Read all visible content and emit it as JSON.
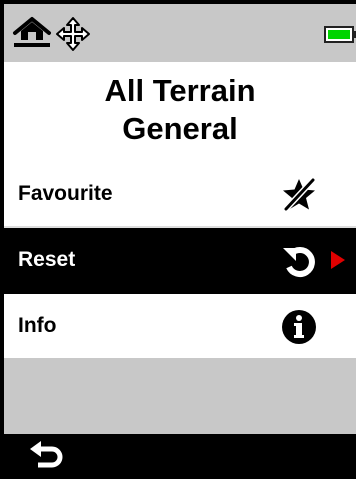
{
  "status_bar": {
    "icons": [
      "all-terrain-mode-icon",
      "pan-icon",
      "battery-icon"
    ],
    "battery_level": 1.0,
    "battery_color": "#00d400"
  },
  "title": {
    "line1": "All Terrain",
    "line2": "General"
  },
  "menu": {
    "items": [
      {
        "label": "Favourite",
        "icon": "favourite-off-icon",
        "selected": false
      },
      {
        "label": "Reset",
        "icon": "reset-icon",
        "selected": true,
        "indicator": "arrow-right-icon"
      },
      {
        "label": "Info",
        "icon": "info-icon",
        "selected": false
      }
    ]
  },
  "colors": {
    "selected_background": "#000000",
    "selected_text": "#ffffff",
    "indicator_arrow": "#e00000",
    "bar_gray": "#c8c8c8"
  },
  "bottom_bar": {
    "icon": "back-icon"
  }
}
